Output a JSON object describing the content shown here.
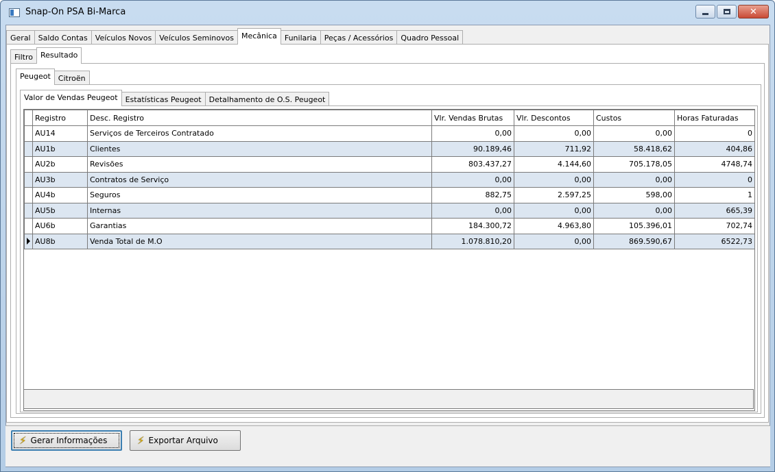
{
  "window": {
    "title": "Snap-On PSA Bi-Marca"
  },
  "main_tabs": [
    "Geral",
    "Saldo Contas",
    "Veículos Novos",
    "Veículos Seminovos",
    "Mecânica",
    "Funilaria",
    "Peças / Acessórios",
    "Quadro Pessoal"
  ],
  "main_tab_active": "Mecânica",
  "sub_tabs": [
    "Filtro",
    "Resultado"
  ],
  "sub_tab_active": "Resultado",
  "brand_tabs": [
    "Peugeot",
    "Citroën"
  ],
  "brand_tab_active": "Peugeot",
  "report_tabs": [
    "Valor de Vendas Peugeot",
    "Estatísticas Peugeot",
    "Detalhamento de O.S. Peugeot"
  ],
  "report_tab_active": "Valor de Vendas Peugeot",
  "grid": {
    "columns": [
      "Registro",
      "Desc. Registro",
      "Vlr. Vendas Brutas",
      "Vlr. Descontos",
      "Custos",
      "Horas Faturadas"
    ],
    "rows": [
      [
        "AU14",
        "Serviços de Terceiros Contratado",
        "0,00",
        "0,00",
        "0,00",
        "0"
      ],
      [
        "AU1b",
        "Clientes",
        "90.189,46",
        "711,92",
        "58.418,62",
        "404,86"
      ],
      [
        "AU2b",
        "Revisões",
        "803.437,27",
        "4.144,60",
        "705.178,05",
        "4748,74"
      ],
      [
        "AU3b",
        "Contratos de Serviço",
        "0,00",
        "0,00",
        "0,00",
        "0"
      ],
      [
        "AU4b",
        "Seguros",
        "882,75",
        "2.597,25",
        "598,00",
        "1"
      ],
      [
        "AU5b",
        "Internas",
        "0,00",
        "0,00",
        "0,00",
        "665,39"
      ],
      [
        "AU6b",
        "Garantias",
        "184.300,72",
        "4.963,80",
        "105.396,01",
        "702,74"
      ],
      [
        "AU8b",
        "Venda Total de M.O",
        "1.078.810,20",
        "0,00",
        "869.590,67",
        "6522,73"
      ]
    ],
    "current_row": 7
  },
  "buttons": {
    "gerar": "Gerar Informações",
    "exportar": "Exportar Arquivo"
  }
}
